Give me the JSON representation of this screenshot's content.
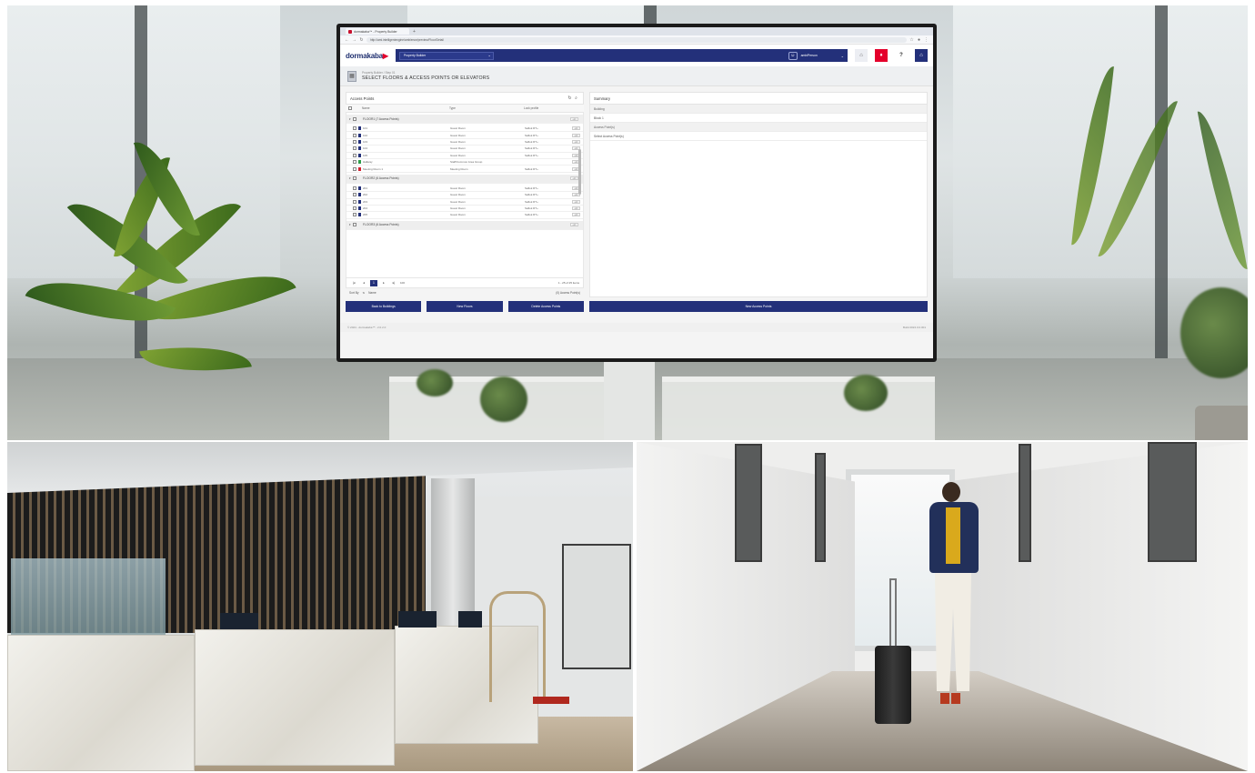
{
  "browser": {
    "tab_title": "dormakaba™ - Property Builder",
    "url": "http://ami.intelligentengine/ambience/preview/Floor/Detail"
  },
  "app": {
    "logo_text": "dormakaba",
    "property_selector": "Property Builder",
    "user_name": "ambiPerson"
  },
  "page": {
    "breadcrumb": "Property Builder / Step 01",
    "title": "SELECT FLOORS & ACCESS POINTS OR ELEVATORS"
  },
  "access_points": {
    "panel_title": "Access Points",
    "columns": [
      "Name",
      "Type",
      "Lock profile"
    ],
    "groups": [
      {
        "label": "FLOOR1 (7 Access Points)",
        "rows": [
          {
            "name": "101",
            "type": "Guest Room",
            "lock": "Saflok RT+",
            "color": "#23307a"
          },
          {
            "name": "102",
            "type": "Guest Room",
            "lock": "Saflok RT+",
            "color": "#23307a"
          },
          {
            "name": "103",
            "type": "Guest Room",
            "lock": "Saflok RT+",
            "color": "#23307a"
          },
          {
            "name": "104",
            "type": "Guest Room",
            "lock": "Saflok RT+",
            "color": "#23307a"
          },
          {
            "name": "105",
            "type": "Guest Room",
            "lock": "Saflok RT+",
            "color": "#23307a"
          },
          {
            "name": "Hallway",
            "type": "Staff/Common Area Group",
            "lock": "",
            "color": "#2e9e4a"
          },
          {
            "name": "Meeting Room 1",
            "type": "Meeting Room",
            "lock": "Saflok RT+",
            "color": "#d2202f"
          }
        ]
      },
      {
        "label": "FLOOR2 (6 Access Points)",
        "rows": [
          {
            "name": "201",
            "type": "Guest Room",
            "lock": "Saflok RT+",
            "color": "#23307a"
          },
          {
            "name": "202",
            "type": "Guest Room",
            "lock": "Saflok RT+",
            "color": "#23307a"
          },
          {
            "name": "203",
            "type": "Guest Room",
            "lock": "Saflok RT+",
            "color": "#23307a"
          },
          {
            "name": "204",
            "type": "Guest Room",
            "lock": "Saflok RT+",
            "color": "#23307a"
          },
          {
            "name": "205",
            "type": "Guest Room",
            "lock": "Saflok RT+",
            "color": "#23307a"
          }
        ]
      },
      {
        "label": "FLOOR3 (6 Access Points)",
        "rows": []
      }
    ],
    "edit_label": "edit",
    "pager": {
      "page": "1",
      "page_size": "100",
      "count": "1 - 25 of 25 items"
    },
    "sort_label": "Sort By",
    "sort_value": "Name",
    "selected_count": "(0) Access Point(s)",
    "buttons": {
      "back": "Back to Buildings",
      "new_floors": "New Floors",
      "delete": "Delete Access Points"
    }
  },
  "summary": {
    "panel_title": "Summary",
    "building_label": "Building",
    "building_value": "Block 1",
    "access_label": "Access Point(s)",
    "access_value": "Select Access Point(s)",
    "new_button": "New Access Points"
  },
  "footer": {
    "left": "© 2024 - dormakaba™ - 2.0.2.0",
    "right": "Build 2024.0.0.001"
  },
  "colors": {
    "brand_navy": "#23307a",
    "brand_red": "#e4002b"
  }
}
